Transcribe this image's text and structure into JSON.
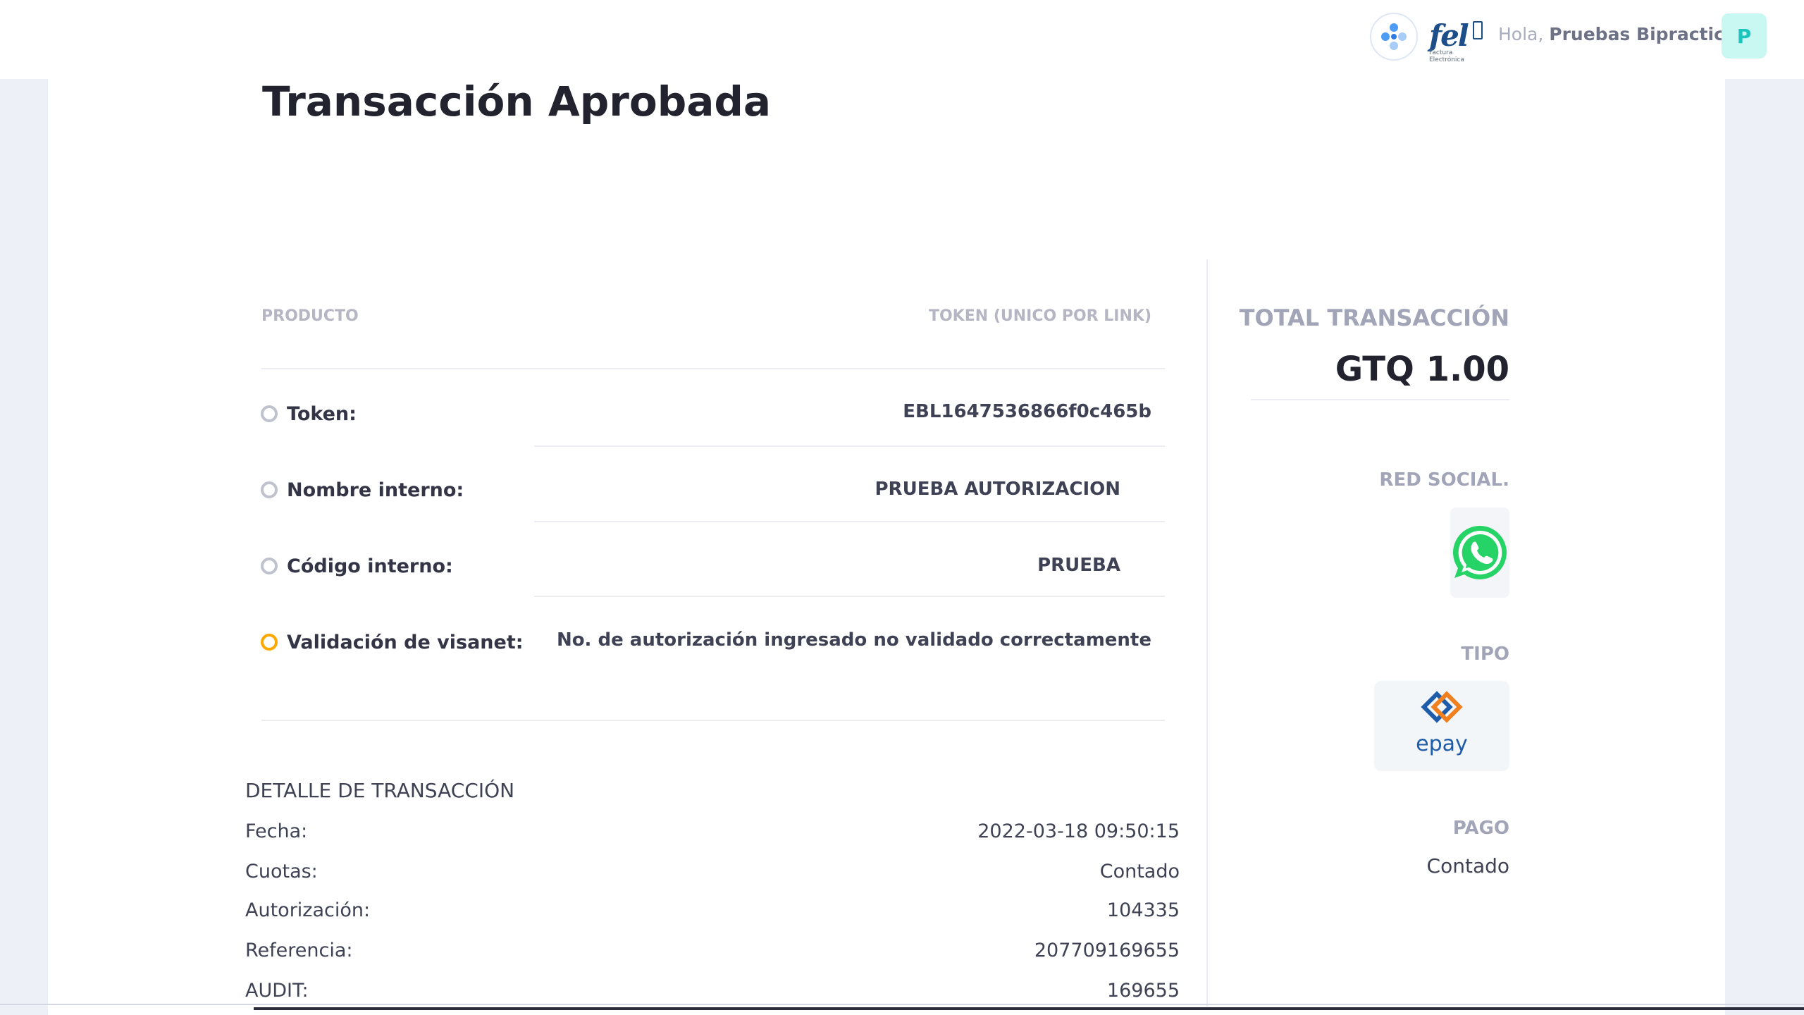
{
  "header": {
    "greeting_prefix": "Hola,",
    "user_name": "Pruebas Bipractico",
    "avatar_initial": "P",
    "fel_logo_text": "fel",
    "fel_logo_subtext": "Factura Electrónica"
  },
  "page": {
    "title": "Transacción Aprobada"
  },
  "product_table": {
    "col_product": "PRODUCTO",
    "col_token": "TOKEN (UNICO POR LINK)",
    "rows": [
      {
        "label": "Token:",
        "value": "EBL1647536866f0c465b",
        "status": "neutral"
      },
      {
        "label": "Nombre interno:",
        "value": "PRUEBA AUTORIZACION",
        "status": "neutral"
      },
      {
        "label": "Código interno:",
        "value": "PRUEBA",
        "status": "neutral"
      },
      {
        "label": "Validación de visanet:",
        "value": "No. de autorización ingresado no validado correctamente",
        "status": "warning"
      }
    ]
  },
  "transaction_detail": {
    "title": "DETALLE DE TRANSACCIÓN",
    "rows": [
      {
        "label": "Fecha:",
        "value": "2022-03-18 09:50:15"
      },
      {
        "label": "Cuotas:",
        "value": "Contado"
      },
      {
        "label": "Autorización:",
        "value": "104335"
      },
      {
        "label": "Referencia:",
        "value": "207709169655"
      },
      {
        "label": "AUDIT:",
        "value": "169655"
      }
    ]
  },
  "sidebar": {
    "total_label": "TOTAL TRANSACCIÓN",
    "total_amount": "GTQ 1.00",
    "social_label": "RED SOCIAL.",
    "social_icon": "whatsapp-icon",
    "type_label": "TIPO",
    "type_logo_text": "epay",
    "payment_label": "PAGO",
    "payment_value": "Contado"
  },
  "colors": {
    "brand": "#1bc5bd",
    "warning": "#ffa800",
    "whatsapp": "#25d366",
    "epay_blue": "#1e5ba8",
    "epay_orange": "#f07f1f"
  }
}
